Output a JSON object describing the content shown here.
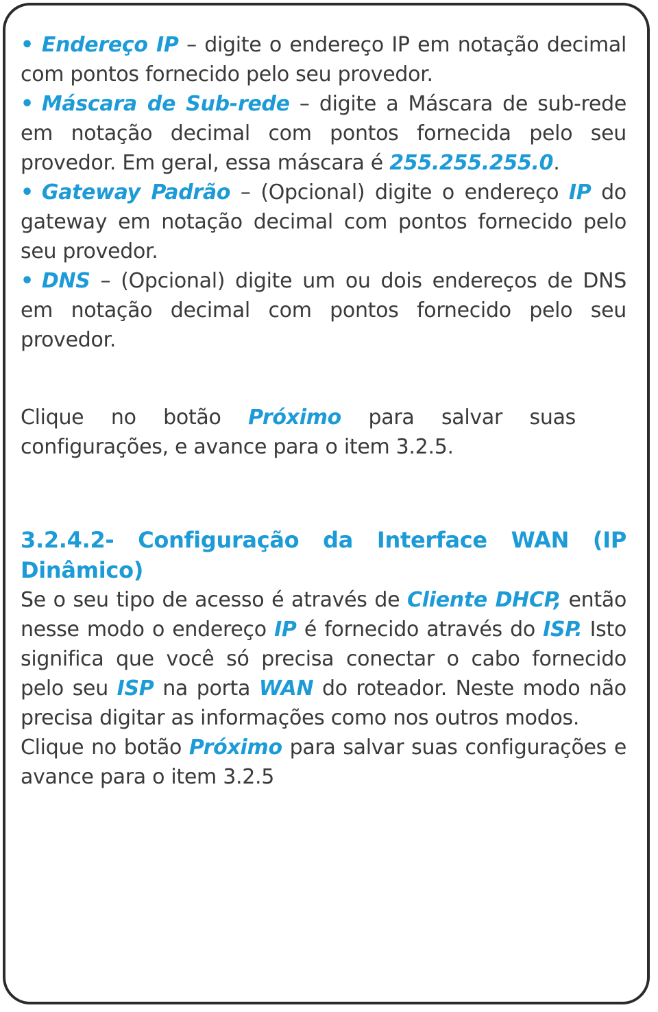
{
  "bullets": [
    {
      "term": "Endereço IP",
      "dash": " – ",
      "text": "digite o endereço IP em notação decimal com pontos fornecido pelo seu provedor."
    },
    {
      "term": "Máscara de Sub-rede",
      "dash": " – ",
      "text_before": "digite a Máscara de sub-rede em notação decimal com pontos fornecida pelo seu provedor. Em geral, essa máscara é ",
      "mask": "255.255.255.0",
      "text_after": "."
    },
    {
      "term": "Gateway Padrão",
      "dash": " – ",
      "text_before": "(Opcional) digite o endereço ",
      "ip": "IP",
      "text_after": " do gateway em notação decimal com pontos fornecido pelo seu provedor."
    },
    {
      "term": "DNS",
      "dash": " – ",
      "text": "(Opcional) digite um ou dois endereços de DNS em notação decimal com pontos fornecido pelo seu provedor."
    }
  ],
  "bullet_glyph": "•",
  "click_next_1": {
    "before": "Clique no botão ",
    "button": "Próximo",
    "after": " para salvar suas configurações, e avance para o item 3.2.5."
  },
  "section": {
    "heading": "3.2.4.2- Configuração da Interface WAN (IP Dinâmico)",
    "p1": {
      "t1": "Se o seu tipo de acesso é através de ",
      "h1": "Cliente DHCP,",
      "t2": " então nesse modo o endereço ",
      "h2": "IP",
      "t3": " é fornecido através do ",
      "h3": "ISP.",
      "t4": " Isto significa que você só precisa conectar o cabo fornecido pelo seu ",
      "h4": "ISP",
      "t5": " na porta ",
      "h5": "WAN",
      "t6": " do roteador. Neste modo não precisa digitar as informações como nos outros modos."
    },
    "click_next_2": {
      "before": "Clique no botão ",
      "button": "Próximo",
      "after": " para salvar suas configurações e avance para o item 3.2.5"
    }
  },
  "colors": {
    "accent": "#1c9bd7",
    "text": "#3a3a3a",
    "border": "#2b2b2b"
  }
}
